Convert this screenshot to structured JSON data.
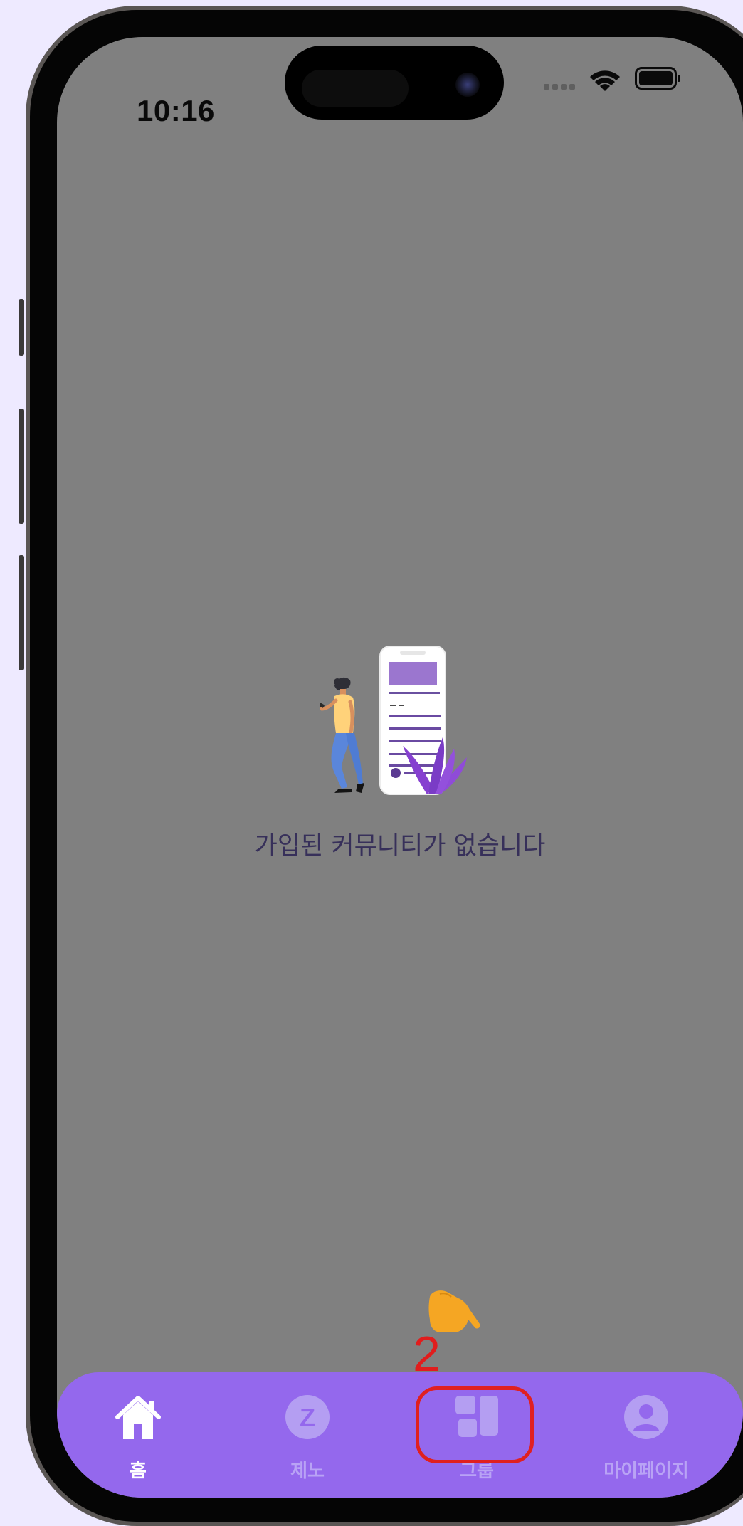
{
  "status_bar": {
    "time": "10:16"
  },
  "main": {
    "empty_message": "가입된 커뮤니티가 없습니다"
  },
  "tab_bar": {
    "items": [
      {
        "label": "홈",
        "icon": "home-icon",
        "active": true
      },
      {
        "label": "제노",
        "icon": "zeno-icon",
        "icon_glyph": "Z",
        "active": false
      },
      {
        "label": "그룹",
        "icon": "group-icon",
        "active": false
      },
      {
        "label": "마이페이지",
        "icon": "person-icon",
        "active": false
      }
    ]
  },
  "annotation": {
    "step_number": "2",
    "pointer_icon": "hand-pointer-icon"
  },
  "colors": {
    "tab_bar": "#9468ed",
    "screen_overlay": "#808080",
    "highlight": "#e02020",
    "pointer": "#f5a623",
    "page_background": "#eeeaff"
  }
}
